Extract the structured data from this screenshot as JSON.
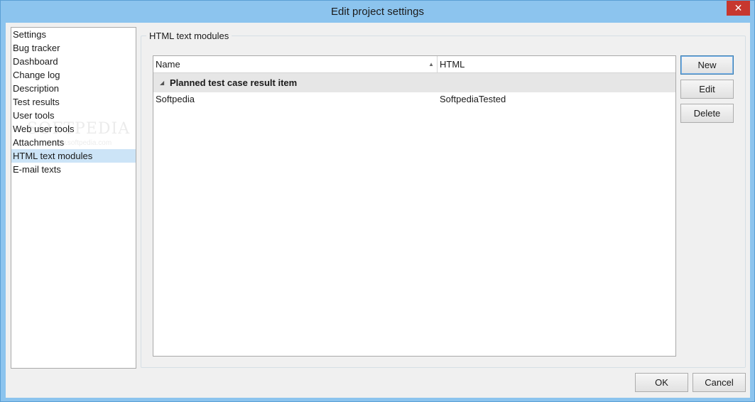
{
  "window": {
    "title": "Edit project settings",
    "close_glyph": "✕"
  },
  "nav": {
    "items": [
      {
        "label": "Settings",
        "selected": false
      },
      {
        "label": "Bug tracker",
        "selected": false
      },
      {
        "label": "Dashboard",
        "selected": false
      },
      {
        "label": "Change log",
        "selected": false
      },
      {
        "label": "Description",
        "selected": false
      },
      {
        "label": "Test results",
        "selected": false
      },
      {
        "label": "User tools",
        "selected": false
      },
      {
        "label": "Web user tools",
        "selected": false
      },
      {
        "label": "Attachments",
        "selected": false
      },
      {
        "label": "HTML text modules",
        "selected": true
      },
      {
        "label": "E-mail texts",
        "selected": false
      }
    ]
  },
  "watermark": {
    "text": "SOFTPEDIA",
    "subtext": "www.softpedia.com"
  },
  "group": {
    "title": "HTML text modules"
  },
  "grid": {
    "columns": [
      "Name",
      "HTML"
    ],
    "sort_icon": "▲",
    "expand_icon": "◢",
    "group_label": "Planned test case result item",
    "rows": [
      {
        "name": "Softpedia",
        "html": "SoftpediaTested"
      }
    ]
  },
  "buttons": {
    "new": "New",
    "edit": "Edit",
    "delete": "Delete",
    "ok": "OK",
    "cancel": "Cancel"
  }
}
